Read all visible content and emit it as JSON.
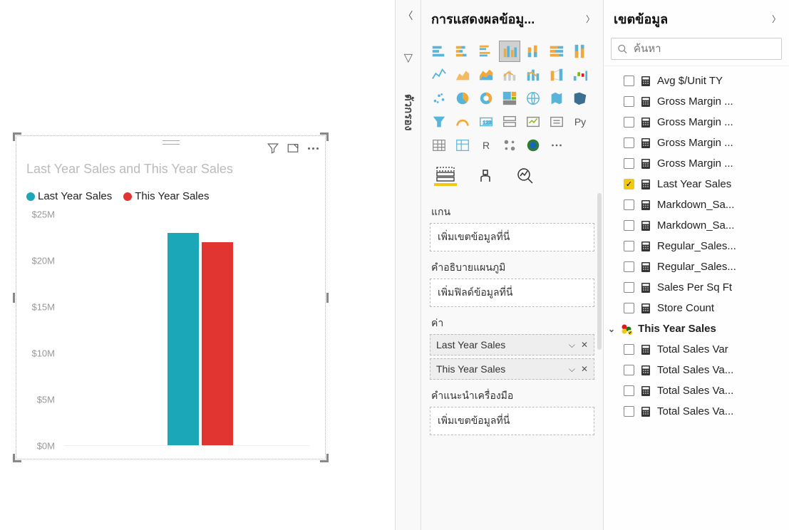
{
  "chart_data": {
    "type": "bar",
    "title": "Last Year Sales and This Year Sales",
    "series": [
      {
        "name": "Last Year Sales",
        "color": "#1ca7b8",
        "value": 23000000
      },
      {
        "name": "This Year Sales",
        "color": "#e03531",
        "value": 22000000
      }
    ],
    "ylabel": "",
    "ylim": [
      0,
      25000000
    ],
    "yticks": [
      {
        "label": "$25M",
        "value": 25000000
      },
      {
        "label": "$20M",
        "value": 20000000
      },
      {
        "label": "$15M",
        "value": 15000000
      },
      {
        "label": "$10M",
        "value": 10000000
      },
      {
        "label": "$5M",
        "value": 5000000
      },
      {
        "label": "$0M",
        "value": 0
      }
    ]
  },
  "viz_pane": {
    "title": "การแสดงผลข้อมู...",
    "wells": {
      "axis_label": "แกน",
      "axis_placeholder": "เพิ่มเขตข้อมูลที่นี่",
      "legend_label": "คำอธิบายแผนภูมิ",
      "legend_placeholder": "เพิ่มฟิลด์ข้อมูลที่นี่",
      "values_label": "ค่า",
      "value_items": [
        "Last Year Sales",
        "This Year Sales"
      ],
      "tooltip_label": "คำแนะนำเครื่องมือ",
      "tooltip_placeholder": "เพิ่มเขตข้อมูลที่นี่"
    }
  },
  "filters_tab": {
    "label": "ตัวกรอง"
  },
  "fields_pane": {
    "title": "เขตข้อมูล",
    "search_placeholder": "ค้นหา",
    "fields": [
      {
        "label": "Avg $/Unit TY",
        "type": "measure",
        "checked": false
      },
      {
        "label": "Gross Margin ...",
        "type": "measure",
        "checked": false
      },
      {
        "label": "Gross Margin ...",
        "type": "measure",
        "checked": false
      },
      {
        "label": "Gross Margin ...",
        "type": "measure",
        "checked": false
      },
      {
        "label": "Gross Margin ...",
        "type": "measure",
        "checked": false
      },
      {
        "label": "Last Year Sales",
        "type": "measure",
        "checked": true
      },
      {
        "label": "Markdown_Sa...",
        "type": "measure",
        "checked": false
      },
      {
        "label": "Markdown_Sa...",
        "type": "measure",
        "checked": false
      },
      {
        "label": "Regular_Sales...",
        "type": "measure",
        "checked": false
      },
      {
        "label": "Regular_Sales...",
        "type": "measure",
        "checked": false
      },
      {
        "label": "Sales Per Sq Ft",
        "type": "measure",
        "checked": false
      },
      {
        "label": "Store Count",
        "type": "measure",
        "checked": false
      },
      {
        "label": "This Year Sales",
        "type": "table",
        "checked": true,
        "expandable": true
      },
      {
        "label": "Total Sales Var",
        "type": "measure",
        "checked": false
      },
      {
        "label": "Total Sales Va...",
        "type": "measure",
        "checked": false
      },
      {
        "label": "Total Sales Va...",
        "type": "measure",
        "checked": false
      },
      {
        "label": "Total Sales Va...",
        "type": "measure",
        "checked": false
      }
    ]
  }
}
